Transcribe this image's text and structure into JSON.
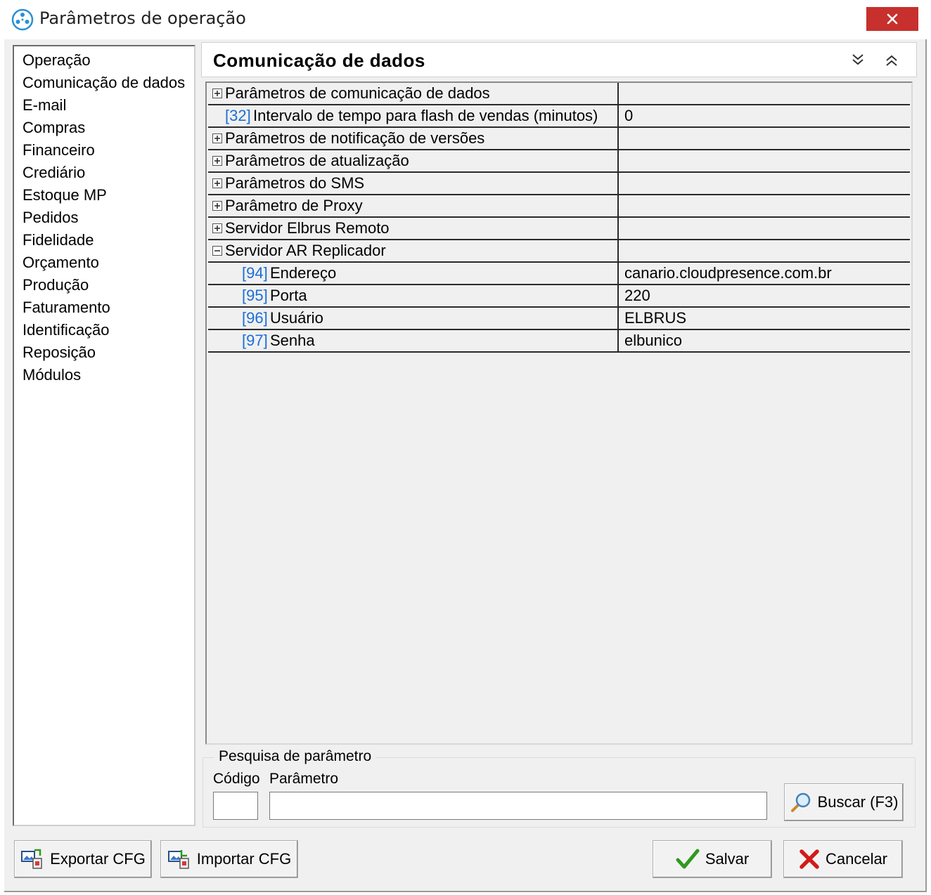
{
  "window": {
    "title": "Parâmetros de operação",
    "close_label": "×"
  },
  "sidebar": {
    "items": [
      {
        "label": "Operação"
      },
      {
        "label": "Comunicação de dados"
      },
      {
        "label": "E-mail"
      },
      {
        "label": "Compras"
      },
      {
        "label": "Financeiro"
      },
      {
        "label": "Crediário"
      },
      {
        "label": "Estoque MP"
      },
      {
        "label": "Pedidos"
      },
      {
        "label": "Fidelidade"
      },
      {
        "label": "Orçamento"
      },
      {
        "label": "Produção"
      },
      {
        "label": "Faturamento"
      },
      {
        "label": "Identificação"
      },
      {
        "label": "Reposição"
      },
      {
        "label": "Módulos"
      }
    ]
  },
  "section": {
    "title": "Comunicação de dados"
  },
  "grid": {
    "rows": [
      {
        "code": "",
        "label": "Parâmetros de comunicação de dados",
        "value": "",
        "expander": "plus"
      },
      {
        "code": "[32]",
        "label": "Intervalo de tempo para flash de vendas (minutos)",
        "value": "0",
        "expander": ""
      },
      {
        "code": "",
        "label": "Parâmetros de notificação de versões",
        "value": "",
        "expander": "plus"
      },
      {
        "code": "",
        "label": "Parâmetros de atualização",
        "value": "",
        "expander": "plus"
      },
      {
        "code": "",
        "label": "Parâmetros do SMS",
        "value": "",
        "expander": "plus"
      },
      {
        "code": "",
        "label": "Parâmetro de Proxy",
        "value": "",
        "expander": "plus"
      },
      {
        "code": "",
        "label": "Servidor Elbrus Remoto",
        "value": "",
        "expander": "plus"
      },
      {
        "code": "",
        "label": "Servidor AR Replicador",
        "value": "",
        "expander": "minus"
      },
      {
        "code": "[94]",
        "label": "Endereço",
        "value": "canario.cloudpresence.com.br",
        "expander": ""
      },
      {
        "code": "[95]",
        "label": "Porta",
        "value": "220",
        "expander": ""
      },
      {
        "code": "[96]",
        "label": "Usuário",
        "value": "ELBRUS",
        "expander": ""
      },
      {
        "code": "[97]",
        "label": "Senha",
        "value": "elbunico",
        "expander": ""
      }
    ]
  },
  "search": {
    "legend": "Pesquisa de parâmetro",
    "codigo_label": "Código",
    "parametro_label": "Parâmetro",
    "codigo_value": "",
    "parametro_value": "",
    "buscar_label": "Buscar (F3)"
  },
  "footer": {
    "export_label": "Exportar CFG",
    "import_label": "Importar CFG",
    "save_label": "Salvar",
    "cancel_label": "Cancelar"
  },
  "colors": {
    "close_button": "#c7302c",
    "code_text": "#1a6fd6",
    "save_check": "#2e9a1e",
    "cancel_x": "#d21a1a"
  }
}
